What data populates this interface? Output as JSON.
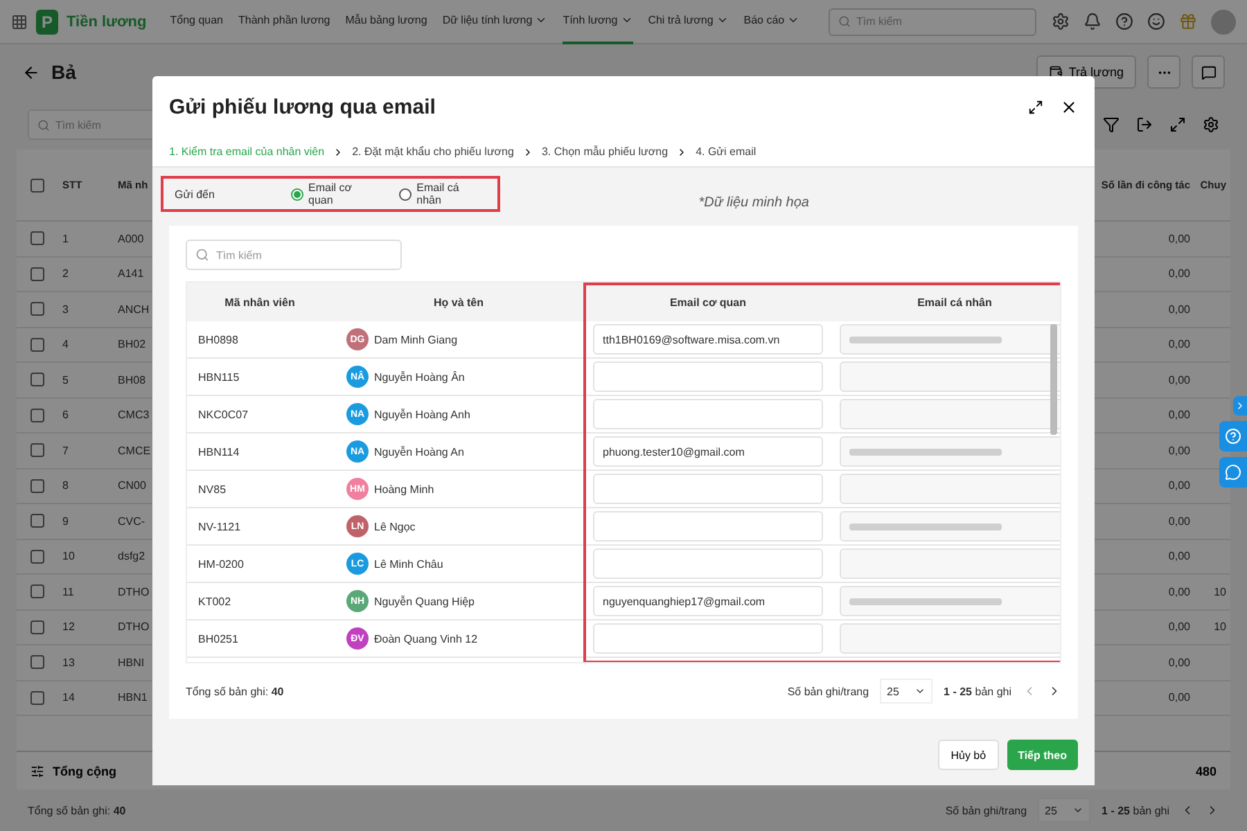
{
  "app": {
    "name": "Tiền lương",
    "logo_letter": "P"
  },
  "nav": [
    {
      "label": "Tổng quan",
      "dropdown": false,
      "selected": false
    },
    {
      "label": "Thành phần lương",
      "dropdown": false,
      "selected": false
    },
    {
      "label": "Mẫu bảng lương",
      "dropdown": false,
      "selected": false
    },
    {
      "label": "Dữ liệu tính lương",
      "dropdown": true,
      "selected": false
    },
    {
      "label": "Tính lương",
      "dropdown": true,
      "selected": true
    },
    {
      "label": "Chi trả lương",
      "dropdown": true,
      "selected": false
    },
    {
      "label": "Báo cáo",
      "dropdown": true,
      "selected": false
    }
  ],
  "global_search": {
    "placeholder": "Tìm kiếm"
  },
  "page": {
    "title": "Bả",
    "pay_button": "Trả lương",
    "search_placeholder": "Tìm kiếm"
  },
  "background_table": {
    "select_all_checked": false,
    "columns": [
      "STT",
      "Mã nh",
      "Số lần đi công tác",
      "Chuy"
    ],
    "rows": [
      {
        "stt": "1",
        "code": "A000",
        "value": "0,00",
        "last": "",
        "checked": false
      },
      {
        "stt": "2",
        "code": "A141",
        "value": "0,00",
        "last": "",
        "checked": false
      },
      {
        "stt": "3",
        "code": "ANCH",
        "value": "0,00",
        "last": "",
        "checked": false
      },
      {
        "stt": "4",
        "code": "BH02",
        "value": "0,00",
        "last": "",
        "checked": false
      },
      {
        "stt": "5",
        "code": "BH08",
        "value": "0,00",
        "last": "",
        "checked": false
      },
      {
        "stt": "6",
        "code": "CMC3",
        "value": "0,00",
        "last": "",
        "checked": false
      },
      {
        "stt": "7",
        "code": "CMCE",
        "value": "0,00",
        "last": "",
        "checked": false
      },
      {
        "stt": "8",
        "code": "CN00",
        "value": "0,00",
        "last": "",
        "checked": false
      },
      {
        "stt": "9",
        "code": "CVC-",
        "value": "0,00",
        "last": "",
        "checked": false
      },
      {
        "stt": "10",
        "code": "dsfg2",
        "value": "0,00",
        "last": "",
        "checked": false
      },
      {
        "stt": "11",
        "code": "DTHO",
        "value": "0,00",
        "last": "10",
        "checked": false
      },
      {
        "stt": "12",
        "code": "DTHO",
        "value": "0,00",
        "last": "10",
        "checked": false
      },
      {
        "stt": "13",
        "code": "HBNI",
        "value": "0,00",
        "last": "",
        "checked": false
      },
      {
        "stt": "14",
        "code": "HBN1",
        "value": "0,00",
        "last": "",
        "checked": false
      }
    ],
    "total_label": "Tổng cộng",
    "total_value": "480",
    "footer": {
      "count_label": "Tổng số bản ghi:",
      "count": "40",
      "per_page_label": "Số bản ghi/trang",
      "per_page": "25",
      "range": "1 - 25",
      "range_suffix": "bản ghi"
    }
  },
  "dialog": {
    "title": "Gửi phiếu lương qua email",
    "steps": [
      {
        "label": "1. Kiểm tra email của nhân viên",
        "selected": true
      },
      {
        "label": "2. Đặt mật khẩu cho phiếu lương",
        "selected": false
      },
      {
        "label": "3. Chọn mẫu phiếu lương",
        "selected": false
      },
      {
        "label": "4. Gửi email",
        "selected": false
      }
    ],
    "send_to_label": "Gửi đến",
    "send_to_options": [
      {
        "label": "Email cơ quan",
        "selected": true
      },
      {
        "label": "Email cá nhân",
        "selected": false
      }
    ],
    "note": "*Dữ liệu minh họa",
    "search_placeholder": "Tìm kiếm",
    "columns": [
      "Mã nhân viên",
      "Họ và tên",
      "Email cơ quan",
      "Email cá nhân"
    ],
    "rows": [
      {
        "code": "BH0898",
        "initials": "DG",
        "color": "#c07078",
        "name": "Dam Minh Giang",
        "work_email": "tth1BH0169@software.misa.com.vn",
        "personal_blurred": true
      },
      {
        "code": "HBN115",
        "initials": "NÂ",
        "color": "#1a9be0",
        "name": "Nguyễn Hoàng Ân",
        "work_email": "",
        "personal_blurred": false
      },
      {
        "code": "NKC0C07",
        "initials": "NA",
        "color": "#1a9be0",
        "name": "Nguyễn Hoàng Anh",
        "work_email": "",
        "personal_blurred": false
      },
      {
        "code": "HBN114",
        "initials": "NA",
        "color": "#1a9be0",
        "name": "Nguyễn Hoàng An",
        "work_email": "phuong.tester10@gmail.com",
        "personal_blurred": true
      },
      {
        "code": "NV85",
        "initials": "HM",
        "color": "#f07fa0",
        "name": "Hoàng Minh",
        "work_email": "",
        "personal_blurred": false
      },
      {
        "code": "NV-1121",
        "initials": "LN",
        "color": "#c0626a",
        "name": "Lê Ngọc",
        "work_email": "",
        "personal_blurred": true
      },
      {
        "code": "HM-0200",
        "initials": "LC",
        "color": "#1a9be0",
        "name": "Lê Minh Châu",
        "work_email": "",
        "personal_blurred": false
      },
      {
        "code": "KT002",
        "initials": "NH",
        "color": "#5aa878",
        "name": "Nguyễn Quang Hiệp",
        "work_email": "nguyenquanghiep17@gmail.com",
        "personal_blurred": true
      },
      {
        "code": "BH0251",
        "initials": "ĐV",
        "color": "#c040c0",
        "name": "Đoàn Quang Vinh 12",
        "work_email": "",
        "personal_blurred": false
      }
    ],
    "footer": {
      "count_label": "Tổng số bản ghi:",
      "count": "40",
      "per_page_label": "Số bản ghi/trang",
      "per_page": "25",
      "range": "1 - 25",
      "range_suffix": "bản ghi"
    },
    "cancel": "Hủy bỏ",
    "next": "Tiếp theo"
  }
}
